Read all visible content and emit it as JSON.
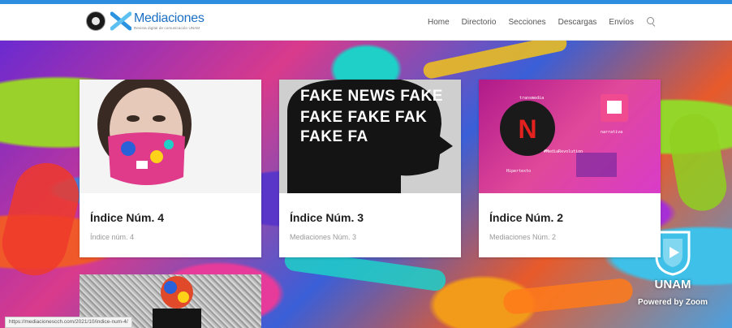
{
  "header": {
    "logo_text": "Mediaciones",
    "logo_tagline": "Revista digital de comunicación UNAM",
    "nav": [
      "Home",
      "Directorio",
      "Secciones",
      "Descargas",
      "Envíos"
    ]
  },
  "cards": [
    {
      "title": "Índice Núm. 4",
      "subtitle": "Índice núm. 4"
    },
    {
      "title": "Índice Núm. 3",
      "subtitle": "Mediaciones Núm. 3"
    },
    {
      "title": "Índice Núm. 2",
      "subtitle": "Mediaciones Núm. 2"
    }
  ],
  "thumbs": {
    "fake_lines": [
      "FAKE NEWS FAKE",
      "FAKE FAKE FAK",
      "FAKE FA"
    ],
    "media_tags": [
      "transmedia",
      "narrativa",
      "#MediaRevolution",
      "Hipertexto"
    ]
  },
  "branding": {
    "institution": "UNAM",
    "powered_by": "Powered by Zoom"
  },
  "status_url": "https://mediacionescch.com/2021/10/indice-num-4/",
  "colors": {
    "accent": "#2d8ee0",
    "brand_blue": "#1a6fc4",
    "card_title": "#1e1e1e",
    "card_subtitle": "#9a9a9a"
  }
}
